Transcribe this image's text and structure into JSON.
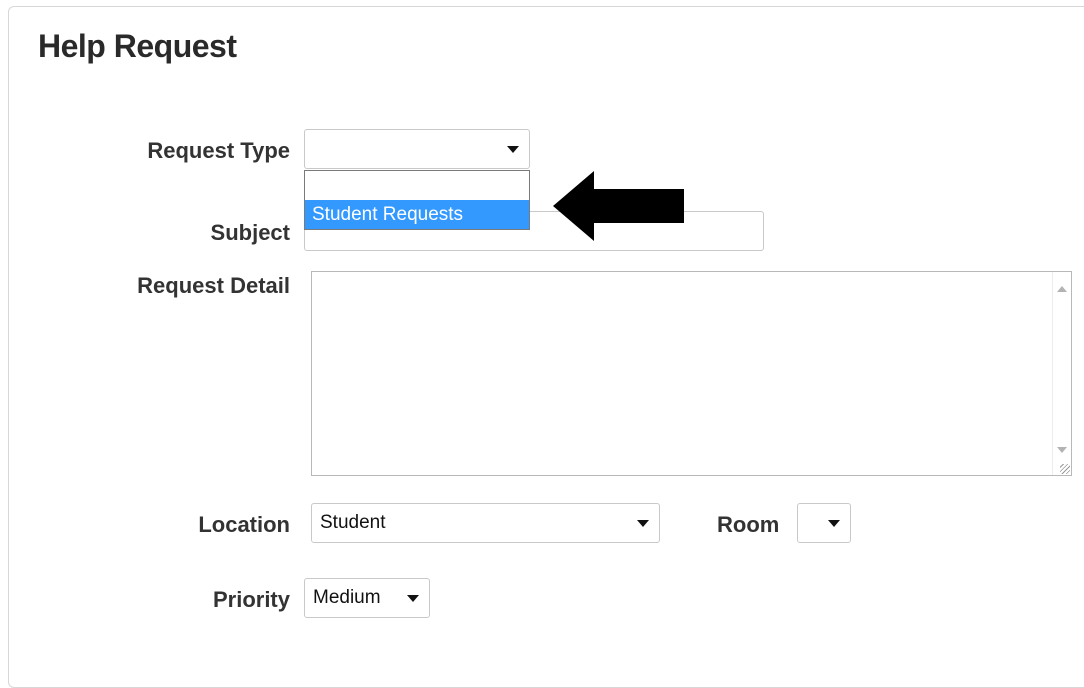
{
  "page": {
    "title": "Help Request"
  },
  "form": {
    "request_type": {
      "label": "Request Type",
      "value": ""
    },
    "request_type_options": [
      "",
      "Student Requests"
    ],
    "request_type_highlighted": "Student Requests",
    "subject": {
      "label": "Subject",
      "value": ""
    },
    "request_detail": {
      "label": "Request Detail",
      "value": ""
    },
    "location": {
      "label": "Location",
      "value": "Student"
    },
    "room": {
      "label": "Room",
      "value": ""
    },
    "priority": {
      "label": "Priority",
      "value": "Medium"
    }
  },
  "colors": {
    "highlight": "#3399ff",
    "arrow": "#000000"
  },
  "icons": [
    "chevron-down-icon",
    "pointer-arrow-icon",
    "scroll-up-icon",
    "scroll-down-icon",
    "resize-grip-icon"
  ]
}
